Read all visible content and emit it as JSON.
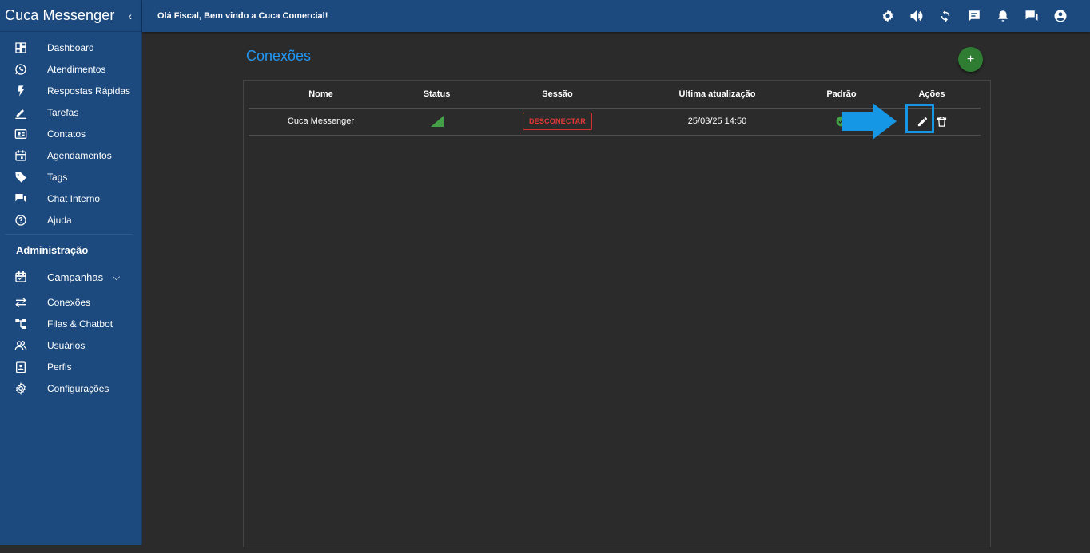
{
  "app": {
    "brand": "Cuca Messenger"
  },
  "header": {
    "welcome": "Olá Fiscal, Bem vindo a Cuca Comercial!",
    "icons": [
      "settings-icon",
      "volume-icon",
      "refresh-icon",
      "message-icon",
      "bell-icon",
      "chat-icon",
      "account-icon"
    ]
  },
  "sidebar": {
    "items": [
      {
        "label": "Dashboard",
        "icon": "dashboard-icon"
      },
      {
        "label": "Atendimentos",
        "icon": "whatsapp-icon"
      },
      {
        "label": "Respostas Rápidas",
        "icon": "bolt-icon"
      },
      {
        "label": "Tarefas",
        "icon": "pencil-icon"
      },
      {
        "label": "Contatos",
        "icon": "contact-card-icon"
      },
      {
        "label": "Agendamentos",
        "icon": "calendar-icon"
      },
      {
        "label": "Tags",
        "icon": "tag-icon"
      },
      {
        "label": "Chat Interno",
        "icon": "forum-icon"
      },
      {
        "label": "Ajuda",
        "icon": "help-icon"
      }
    ],
    "admin_title": "Administração",
    "admin_group": {
      "label": "Campanhas",
      "icon": "event-icon"
    },
    "admin_items": [
      {
        "label": "Conexões",
        "icon": "swap-icon"
      },
      {
        "label": "Filas & Chatbot",
        "icon": "tree-icon"
      },
      {
        "label": "Usuários",
        "icon": "users-icon"
      },
      {
        "label": "Perfis",
        "icon": "badge-icon"
      },
      {
        "label": "Configurações",
        "icon": "gear-icon"
      }
    ]
  },
  "main": {
    "title": "Conexões",
    "add_label": "+",
    "columns": [
      "Nome",
      "Status",
      "Sessão",
      "Última atualização",
      "Padrão",
      "Ações"
    ],
    "rows": [
      {
        "name": "Cuca Messenger",
        "status": "connected",
        "session_action": "DESCONECTAR",
        "updated": "25/03/25 14:50",
        "default": true
      }
    ]
  },
  "colors": {
    "sidebar": "#1c4a7e",
    "background": "#2b2b2b",
    "accent": "#2196f3",
    "add_button": "#2e7d32",
    "disconnect": "#e53935",
    "highlight": "#1597e5"
  }
}
